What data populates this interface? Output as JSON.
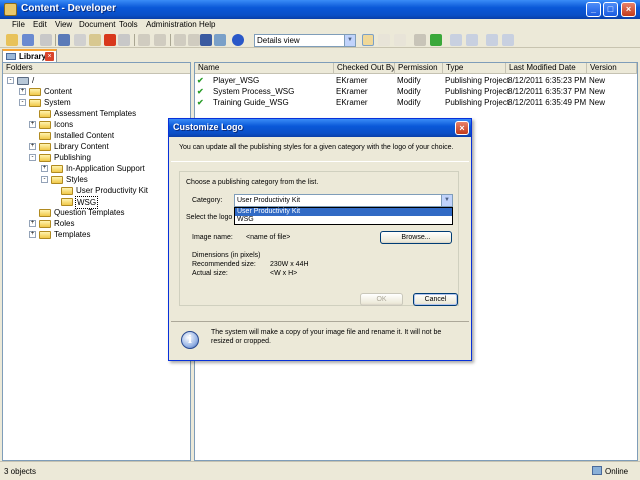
{
  "window": {
    "title": "Content - Developer"
  },
  "menu": [
    "File",
    "Edit",
    "View",
    "Document",
    "Tools",
    "Administration",
    "Help"
  ],
  "toolbar": {
    "view_select": "Details view"
  },
  "library_tab": {
    "label": "Library"
  },
  "folders": {
    "header": "Folders",
    "tree": [
      {
        "label": "/",
        "exp": "-"
      },
      {
        "label": "Content",
        "exp": "+"
      },
      {
        "label": "System",
        "exp": "-"
      },
      {
        "label": "Assessment Templates",
        "exp": ""
      },
      {
        "label": "Icons",
        "exp": "+"
      },
      {
        "label": "Installed Content",
        "exp": ""
      },
      {
        "label": "Library Content",
        "exp": "+"
      },
      {
        "label": "Publishing",
        "exp": "-"
      },
      {
        "label": "In-Application Support",
        "exp": "+"
      },
      {
        "label": "Styles",
        "exp": "-"
      },
      {
        "label": "User Productivity Kit",
        "exp": ""
      },
      {
        "label": "WSG",
        "exp": ""
      },
      {
        "label": "Question Templates",
        "exp": ""
      },
      {
        "label": "Roles",
        "exp": "+"
      },
      {
        "label": "Templates",
        "exp": "+"
      }
    ]
  },
  "list": {
    "columns": [
      "Name",
      "Checked Out By",
      "Permission",
      "Type",
      "Last Modified Date",
      "Version"
    ],
    "rows": [
      {
        "name": "Player_WSG",
        "checked_out_by": "EKramer",
        "permission": "Modify",
        "type": "Publishing Project",
        "modified": "8/12/2011 6:35:23 PM",
        "version": "New"
      },
      {
        "name": "System Process_WSG",
        "checked_out_by": "EKramer",
        "permission": "Modify",
        "type": "Publishing Project",
        "modified": "8/12/2011 6:35:37 PM",
        "version": "New"
      },
      {
        "name": "Training Guide_WSG",
        "checked_out_by": "EKramer",
        "permission": "Modify",
        "type": "Publishing Project",
        "modified": "8/12/2011 6:35:49 PM",
        "version": "New"
      }
    ]
  },
  "status": {
    "objects": "3 objects",
    "online": "Online"
  },
  "dialog": {
    "title": "Customize Logo",
    "intro": "You can update all the publishing styles for a given category with the logo of your choice.",
    "choose_label": "Choose a publishing category from the list.",
    "category_label": "Category:",
    "category_value": "User Productivity Kit",
    "options": [
      "User Productivity Kit",
      "WSG"
    ],
    "select_logo_label": "Select the logo",
    "image_name_label": "Image name:",
    "image_name_value": "<name of file>",
    "browse": "Browse...",
    "dimensions_label": "Dimensions (in pixels)",
    "recommended_label": "Recommended size:",
    "recommended_value": "230W x 44H",
    "actual_label": "Actual size:",
    "actual_value": "<W x H>",
    "ok": "OK",
    "cancel": "Cancel",
    "info": "The system will make a copy of your image file and rename it. It will not be resized or cropped."
  }
}
